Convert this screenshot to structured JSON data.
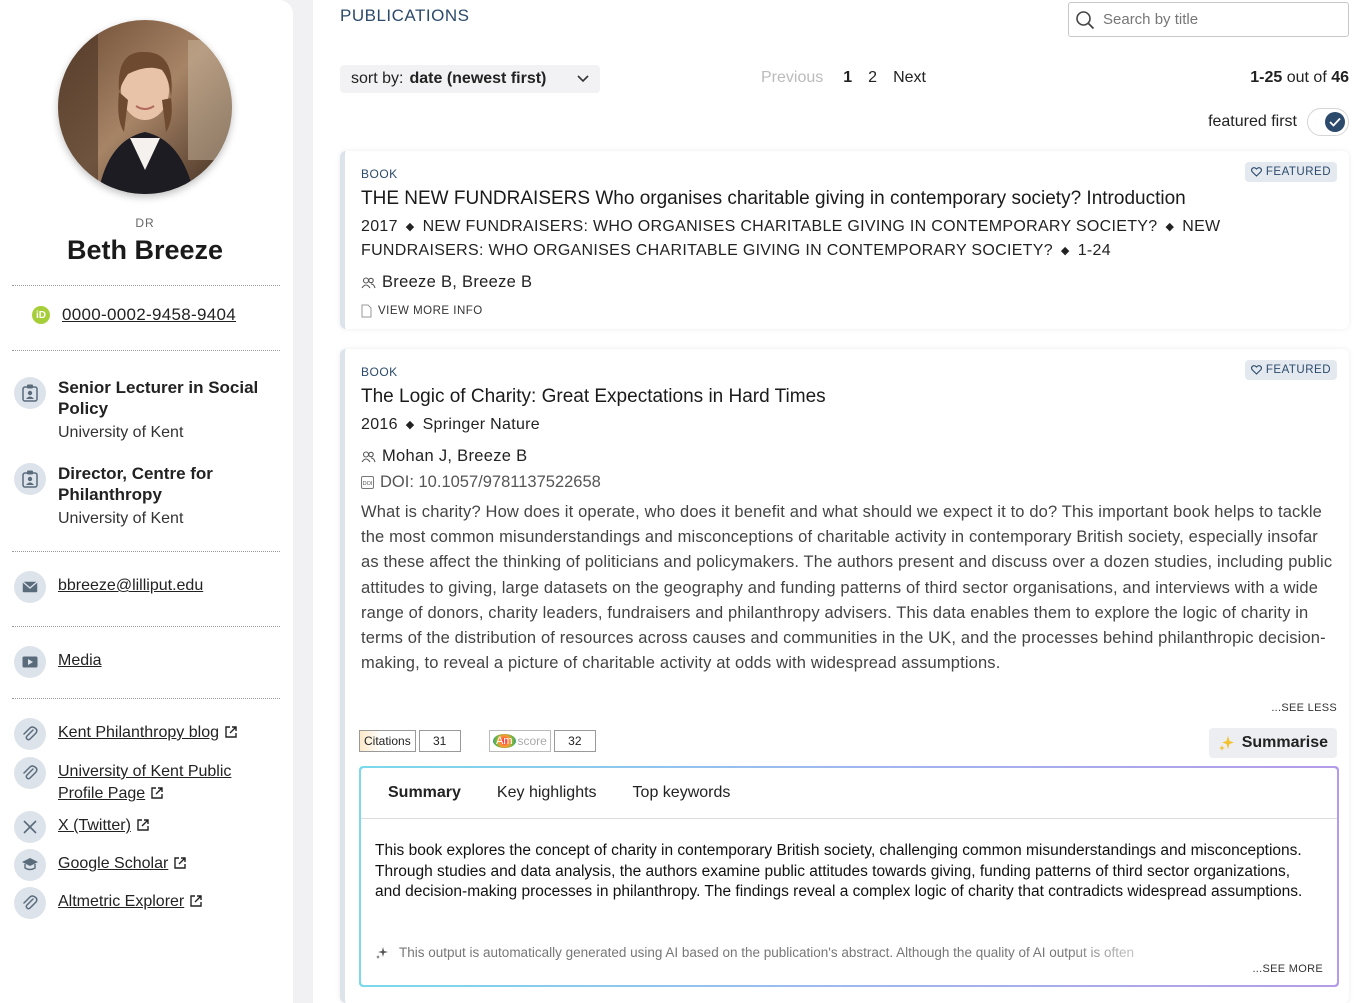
{
  "profile": {
    "title": "DR",
    "name": "Beth Breeze",
    "orcid": "0000-0002-9458-9404",
    "positions": [
      {
        "title": "Senior Lecturer in Social Policy",
        "org": "University of Kent"
      },
      {
        "title": "Director, Centre for Philanthropy",
        "org": "University of Kent"
      }
    ],
    "email": "bbreeze@lilliput.edu",
    "media": "Media",
    "links": [
      "Kent Philanthropy blog",
      "University of Kent Public Profile Page",
      "X (Twitter)",
      "Google Scholar",
      "Altmetric Explorer"
    ]
  },
  "main": {
    "heading": "PUBLICATIONS",
    "search_placeholder": "Search by title",
    "sort_label": "sort by:",
    "sort_value": "date (newest first)",
    "pager": {
      "previous": "Previous",
      "page1": "1",
      "page2": "2",
      "next": "Next"
    },
    "count_range": "1-25",
    "count_text": " out of ",
    "count_total": "46",
    "featured_first": "featured first",
    "featured_first_on": true
  },
  "publications": [
    {
      "type": "BOOK",
      "featured": "FEATURED",
      "title": "THE NEW FUNDRAISERS Who organises charitable giving in contemporary society? Introduction",
      "year": "2017",
      "meta1": "NEW FUNDRAISERS: WHO ORGANISES CHARITABLE GIVING IN CONTEMPORARY SOCIETY?",
      "meta2": "NEW FUNDRAISERS: WHO ORGANISES CHARITABLE GIVING IN CONTEMPORARY SOCIETY?",
      "pages": "1-24",
      "authors": "Breeze B, Breeze B",
      "view_more": "VIEW MORE INFO"
    },
    {
      "type": "BOOK",
      "featured": "FEATURED",
      "title": "The Logic of Charity: Great Expectations in Hard Times",
      "year": "2016",
      "publisher": "Springer Nature",
      "authors": "Mohan J, Breeze B",
      "doi": "DOI: 10.1057/9781137522658",
      "abstract": "What is charity? How does it operate, who does it benefit and what should we expect it to do? This important book helps to tackle the most common misunderstandings and misconceptions of charitable activity in contemporary British society, especially insofar as these affect the thinking of politicians and policymakers. The authors present and discuss over a dozen studies, including public attitudes to giving, large datasets on the geography and funding patterns of third sector organisations, and interviews with a wide range of donors, charity leaders, fundraisers and philanthropy advisers. This data enables them to explore the logic of charity in terms of the distribution of resources across causes and communities in the UK, and the processes behind philanthropic decision-making, to reveal a picture of charitable activity at odds with widespread assumptions.",
      "see_less": "...SEE LESS",
      "citations_label": "Citations",
      "citations": "31",
      "altmetric_am": "Am",
      "altmetric_label": "score",
      "altmetric": "32",
      "summarise": "Summarise",
      "tabs": [
        "Summary",
        "Key highlights",
        "Top keywords"
      ],
      "summary": "This book explores the concept of charity in contemporary British society, challenging common misunderstandings and misconceptions. Through studies and data analysis, the authors examine public attitudes towards giving, funding patterns of third sector organizations, and decision-making processes in philanthropy. The findings reveal a complex logic of charity that contradicts widespread assumptions.",
      "disclaimer": "This output is automatically generated using AI based on the publication's abstract. Although the quality of AI output is often",
      "see_more": "...SEE MORE"
    }
  ],
  "colors": {
    "accent": "#2c4a6b",
    "orcid": "#a6ce39"
  }
}
